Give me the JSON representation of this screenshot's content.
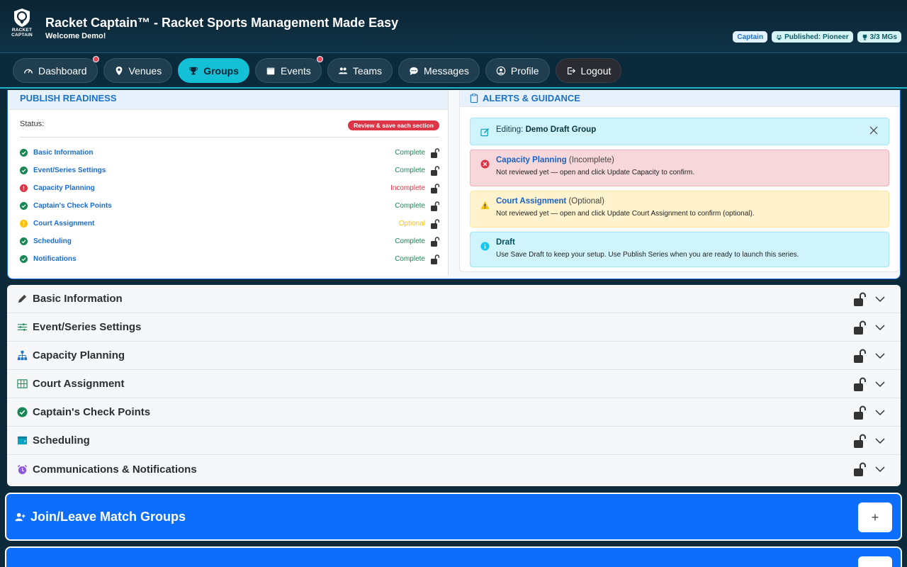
{
  "header": {
    "logo_text_1": "RACKET",
    "logo_text_2": "CAPTAIN",
    "title": "Racket Captain™ - Racket Sports Management Made Easy",
    "welcome": "Welcome Demo!",
    "badges": {
      "captain": "Captain",
      "published": "Published: Pioneer",
      "mgs": "3/3 MGs"
    }
  },
  "nav": {
    "dashboard": "Dashboard",
    "venues": "Venues",
    "groups": "Groups",
    "events": "Events",
    "teams": "Teams",
    "messages": "Messages",
    "profile": "Profile",
    "logout": "Logout"
  },
  "publish": {
    "heading": "PUBLISH READINESS",
    "status_label": "Status:",
    "status_pill": "Review & save each section",
    "items": [
      {
        "name": "Basic Information",
        "status": "Complete"
      },
      {
        "name": "Event/Series Settings",
        "status": "Complete"
      },
      {
        "name": "Capacity Planning",
        "status": "Incomplete"
      },
      {
        "name": "Captain's Check Points",
        "status": "Complete"
      },
      {
        "name": "Court Assignment",
        "status": "Optional"
      },
      {
        "name": "Scheduling",
        "status": "Complete"
      },
      {
        "name": "Notifications",
        "status": "Complete"
      }
    ]
  },
  "alerts": {
    "heading": "ALERTS & GUIDANCE",
    "editing_label": "Editing:",
    "editing_name": "Demo Draft Group",
    "capacity": {
      "title": "Capacity Planning",
      "state": "(Incomplete)",
      "body": "Not reviewed yet — open and click Update Capacity to confirm."
    },
    "court": {
      "title": "Court Assignment",
      "state": "(Optional)",
      "body": "Not reviewed yet — open and click Update Court Assignment to confirm (optional)."
    },
    "draft": {
      "title": "Draft",
      "body": "Use Save Draft to keep your setup. Use Publish Series when you are ready to launch this series."
    }
  },
  "sections": [
    {
      "label": "Basic Information",
      "icon": "pencil-icon"
    },
    {
      "label": "Event/Series Settings",
      "icon": "sliders-icon"
    },
    {
      "label": "Capacity Planning",
      "icon": "hierarchy-icon"
    },
    {
      "label": "Court Assignment",
      "icon": "grid-icon"
    },
    {
      "label": "Captain's Check Points",
      "icon": "check-circle-icon"
    },
    {
      "label": "Scheduling",
      "icon": "wallet-icon"
    },
    {
      "label": "Communications & Notifications",
      "icon": "alarm-icon"
    }
  ],
  "bars": {
    "join_label": "Join/Leave Match Groups",
    "plus": "+"
  },
  "colors": {
    "accent_cyan": "#13c0d6",
    "primary_blue": "#0d6efd",
    "success": "#198754",
    "danger": "#dc3545",
    "warning": "#ffc107"
  }
}
